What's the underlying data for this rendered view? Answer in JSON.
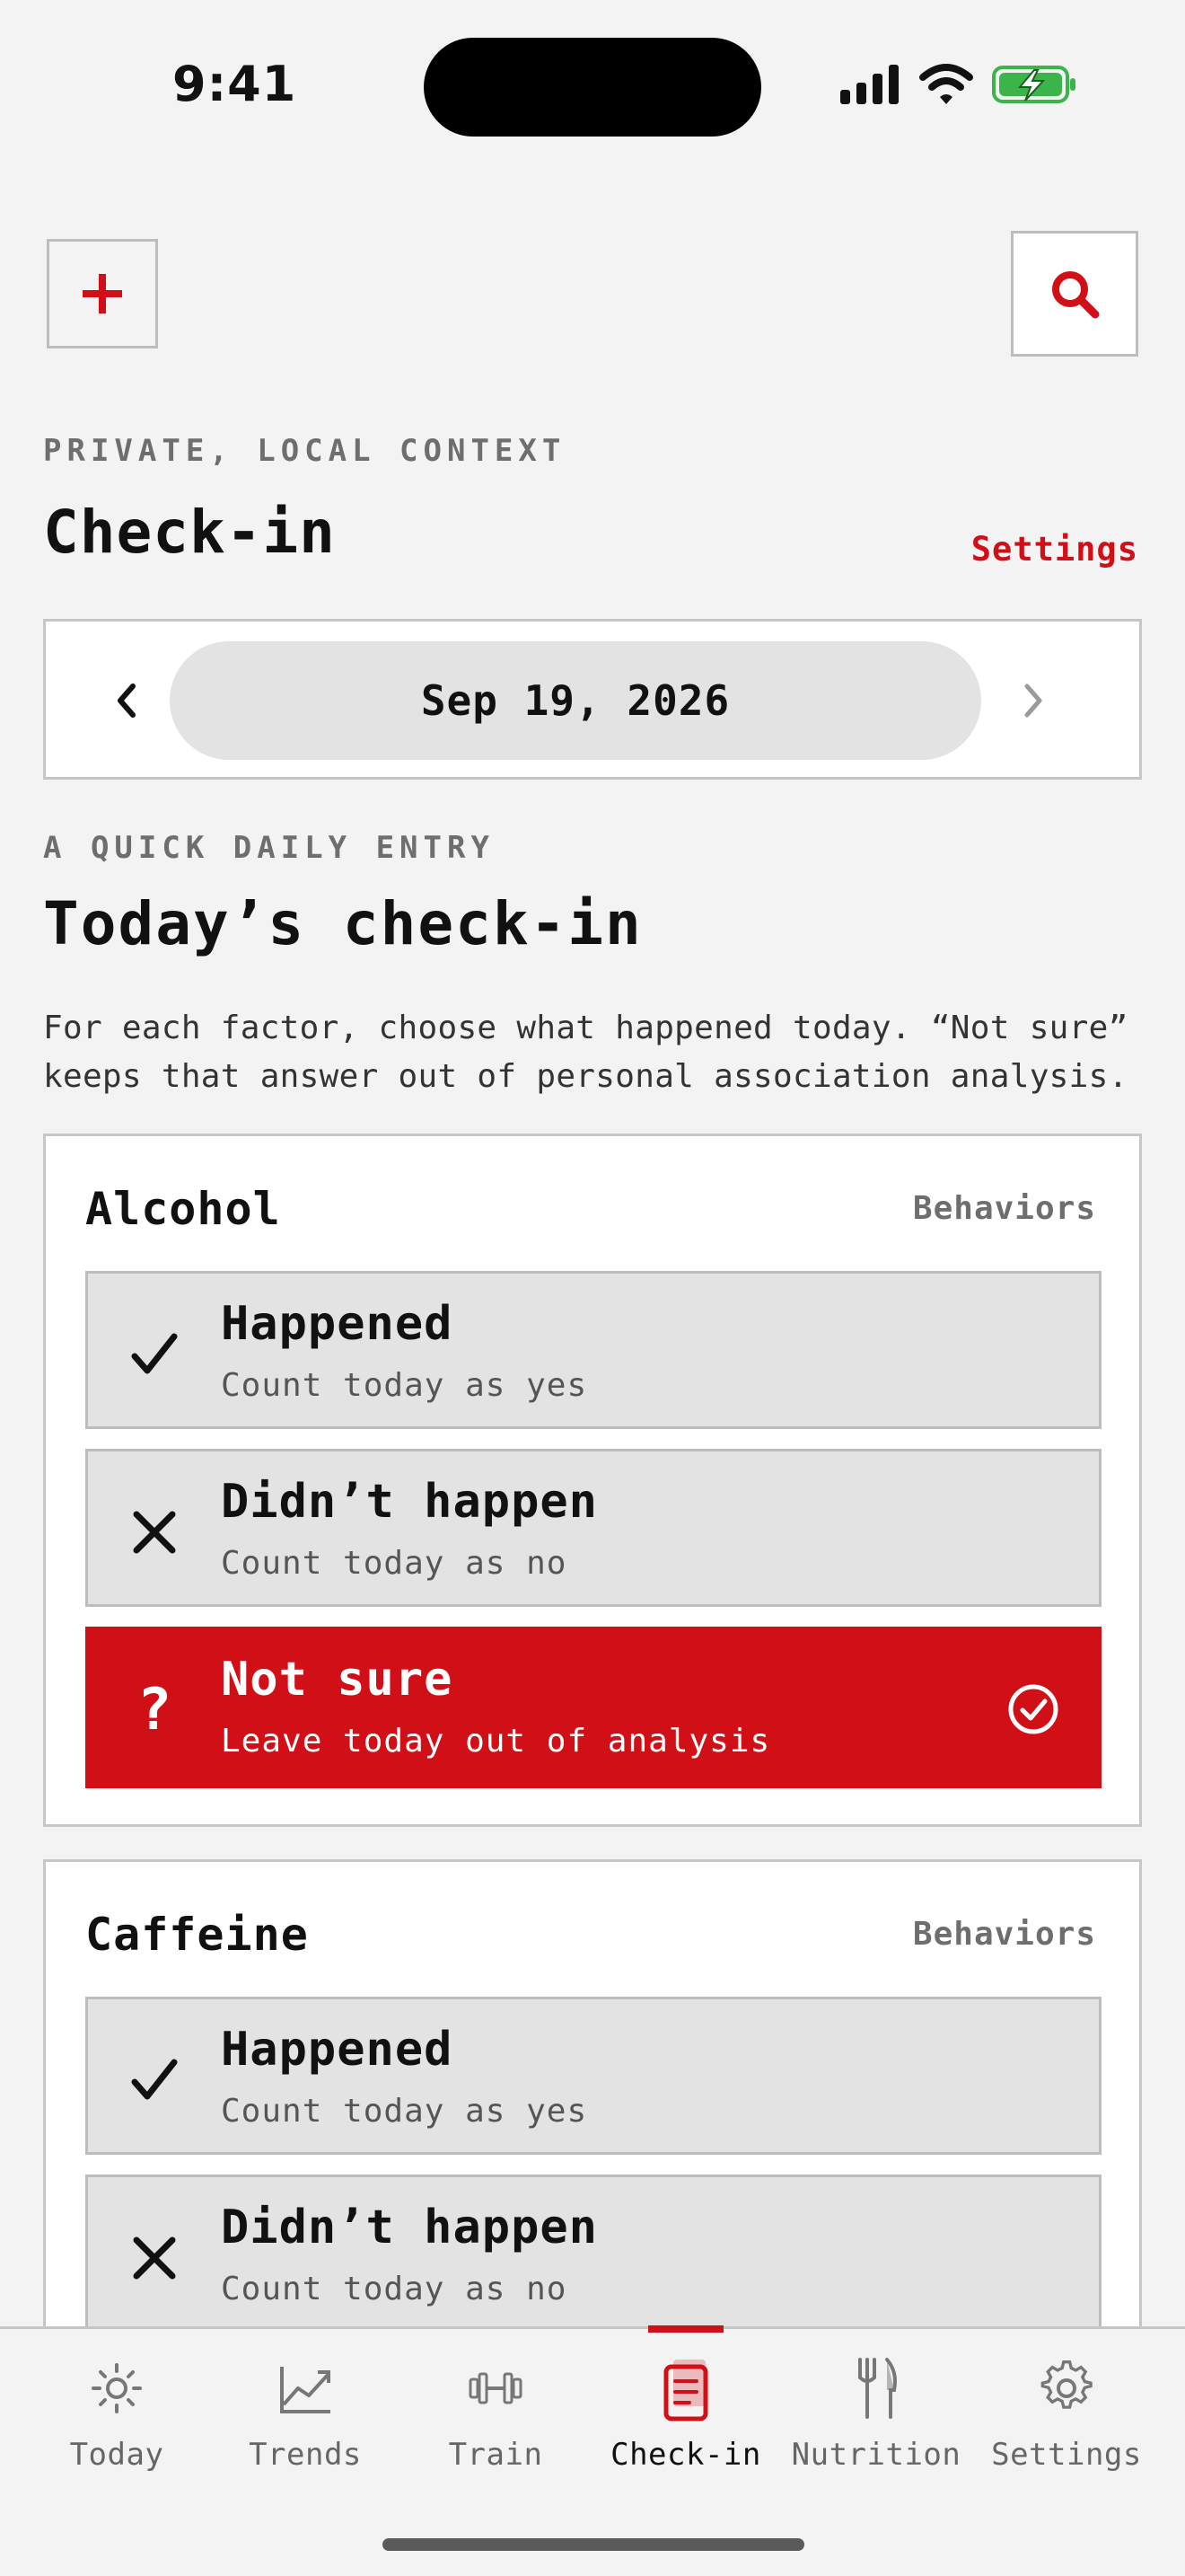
{
  "status": {
    "time": "9:41"
  },
  "header": {
    "eyebrow": "PRIVATE, LOCAL CONTEXT",
    "title": "Check-in",
    "settings_link": "Settings"
  },
  "date_selector": {
    "date": "Sep 19, 2026"
  },
  "section": {
    "eyebrow": "A QUICK DAILY ENTRY",
    "title": "Today’s check-in",
    "intro": "For each factor, choose what happened today. “Not sure” keeps that answer out of personal association analysis."
  },
  "factors": [
    {
      "name": "Alcohol",
      "category": "Behaviors",
      "options": [
        {
          "label": "Happened",
          "sub": "Count today as yes",
          "icon": "checkmark-icon",
          "selected": false
        },
        {
          "label": "Didn’t happen",
          "sub": "Count today as no",
          "icon": "x-icon",
          "selected": false
        },
        {
          "label": "Not sure",
          "sub": "Leave today out of analysis",
          "icon": "question-icon",
          "selected": true
        }
      ]
    },
    {
      "name": "Caffeine",
      "category": "Behaviors",
      "options": [
        {
          "label": "Happened",
          "sub": "Count today as yes",
          "icon": "checkmark-icon",
          "selected": false
        },
        {
          "label": "Didn’t happen",
          "sub": "Count today as no",
          "icon": "x-icon",
          "selected": false
        }
      ]
    }
  ],
  "tabs": [
    {
      "label": "Today",
      "icon": "sun-icon"
    },
    {
      "label": "Trends",
      "icon": "trend-chart-icon"
    },
    {
      "label": "Train",
      "icon": "dumbbell-icon"
    },
    {
      "label": "Check-in",
      "icon": "clipboard-icon",
      "active": true
    },
    {
      "label": "Nutrition",
      "icon": "fork-knife-icon"
    },
    {
      "label": "Settings",
      "icon": "gear-icon"
    }
  ],
  "colors": {
    "accent": "#d10f17",
    "background": "#f3f3f3",
    "option_bg": "#e3e3e3"
  }
}
